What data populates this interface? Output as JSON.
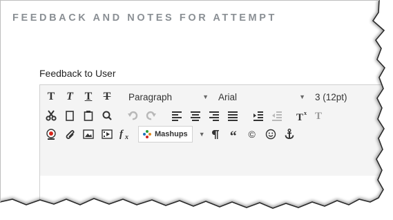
{
  "header": {
    "title": "FEEDBACK AND NOTES FOR ATTEMPT"
  },
  "feedback": {
    "label": "Feedback to User"
  },
  "toolbar": {
    "row1": {
      "bold": "T",
      "italic": "T",
      "underline": "T",
      "strike": "T",
      "format_value": "Paragraph",
      "font_value": "Arial",
      "size_value": "3 (12pt)"
    },
    "row3": {
      "mashups_label": "Mashups",
      "quote": "“",
      "copyright": "©"
    }
  }
}
